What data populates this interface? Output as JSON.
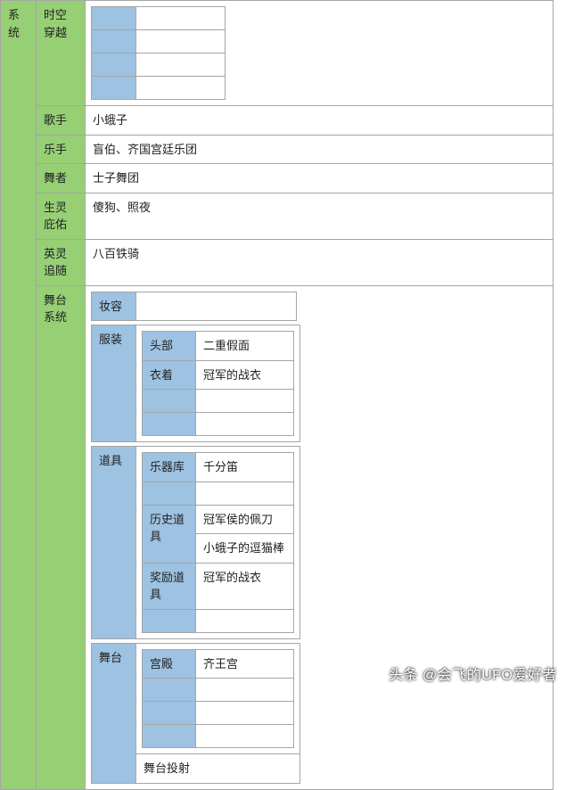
{
  "root_label": "系统",
  "rows": {
    "time_travel": "时空穿越",
    "singer": {
      "label": "歌手",
      "value": "小蛾子"
    },
    "musician": {
      "label": "乐手",
      "value": "盲伯、齐国宫廷乐团"
    },
    "dancer": {
      "label": "舞者",
      "value": "士子舞团"
    },
    "spirit": {
      "label": "生灵庇佑",
      "value": "傻狗、照夜"
    },
    "hero": {
      "label": "英灵追随",
      "value": "八百铁骑"
    },
    "stage_system": "舞台系统"
  },
  "stage": {
    "makeup": "妆容",
    "costume": {
      "label": "服装",
      "head": {
        "label": "头部",
        "value": "二重假面"
      },
      "clothes": {
        "label": "衣着",
        "value": "冠军的战衣"
      }
    },
    "props": {
      "label": "道具",
      "instruments": {
        "label": "乐器库",
        "value": "千分笛"
      },
      "history": {
        "label": "历史道具",
        "value1": "冠军侯的佩刀",
        "value2": "小蛾子的逗猫棒"
      },
      "reward": {
        "label": "奖励道具",
        "value": "冠军的战衣"
      }
    },
    "stage": {
      "label": "舞台",
      "palace": {
        "label": "宫殿",
        "value": "齐王宫"
      },
      "projection": "舞台投射"
    }
  },
  "watermark": "头条 @会飞的UFO爱好者"
}
